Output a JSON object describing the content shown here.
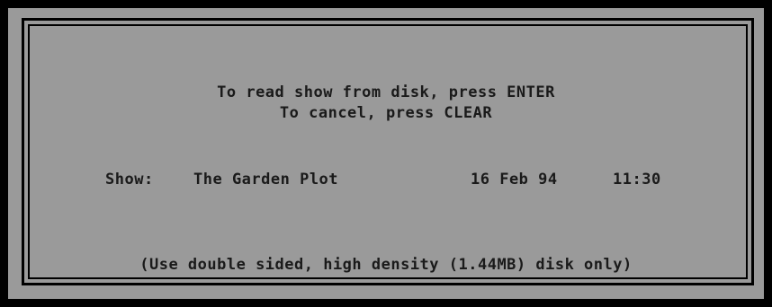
{
  "prompt": {
    "read_line": "To read show from disk, press ENTER",
    "cancel_line": "To cancel, press CLEAR"
  },
  "show": {
    "label": "Show:",
    "title": "The Garden Plot",
    "date": "16 Feb 94",
    "time": "11:30"
  },
  "footer": {
    "note": "(Use double sided, high density (1.44MB) disk only)"
  },
  "colors": {
    "screen_background": "#000000",
    "dialog_background": "#9a9a9a",
    "border": "#000000",
    "text": "#1a1a1a"
  }
}
